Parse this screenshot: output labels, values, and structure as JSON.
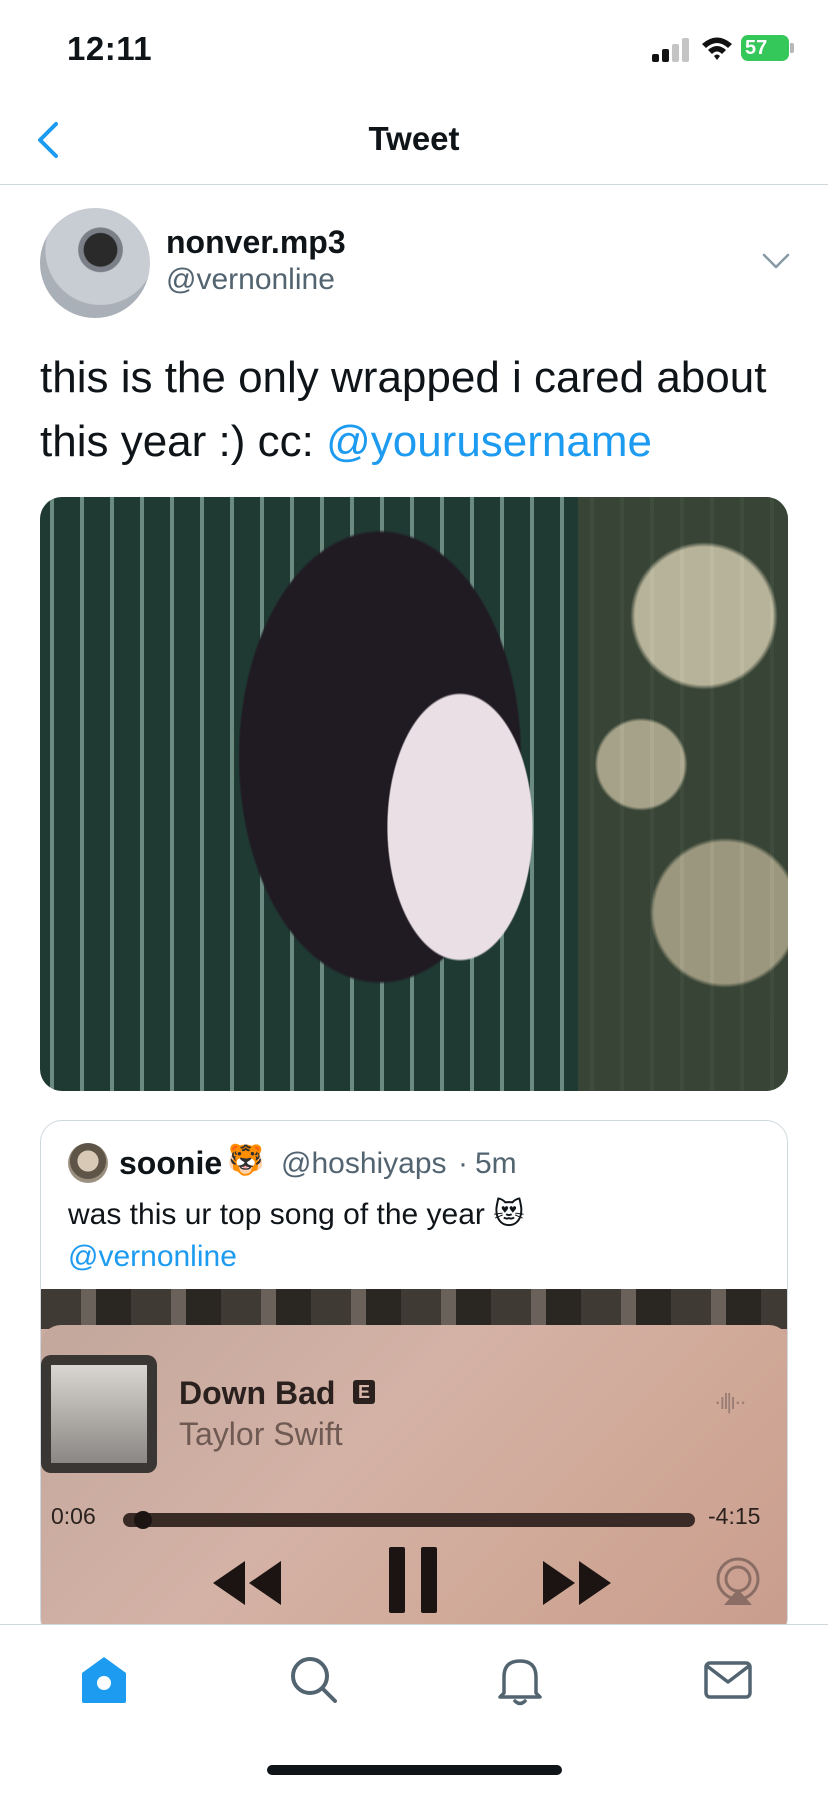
{
  "status_bar": {
    "time": "12:11",
    "battery": "57"
  },
  "header": {
    "title": "Tweet"
  },
  "tweet": {
    "author_name": "nonver.mp3",
    "author_handle": "@vernonline",
    "text_prefix": "this is the only wrapped i cared about this year :) cc: ",
    "mention": "@yourusername"
  },
  "quote": {
    "author_name": "soonie",
    "author_emoji": "🐯",
    "author_handle": "@hoshiyaps",
    "separator": "·",
    "time": "5m",
    "text": "was this ur top song of the year",
    "text_emoji": "😻",
    "mention": "@vernonline"
  },
  "player": {
    "song_title": "Down Bad",
    "explicit": "E",
    "artist": "Taylor Swift",
    "elapsed": "0:06",
    "remaining": "-4:15",
    "progress": 0.02,
    "more": "·ıl|ı··"
  },
  "tabbar": {
    "items": [
      "home-icon",
      "search-icon",
      "bell-icon",
      "mail-icon"
    ],
    "active": "home-icon",
    "accent": "#1d9bf0"
  }
}
